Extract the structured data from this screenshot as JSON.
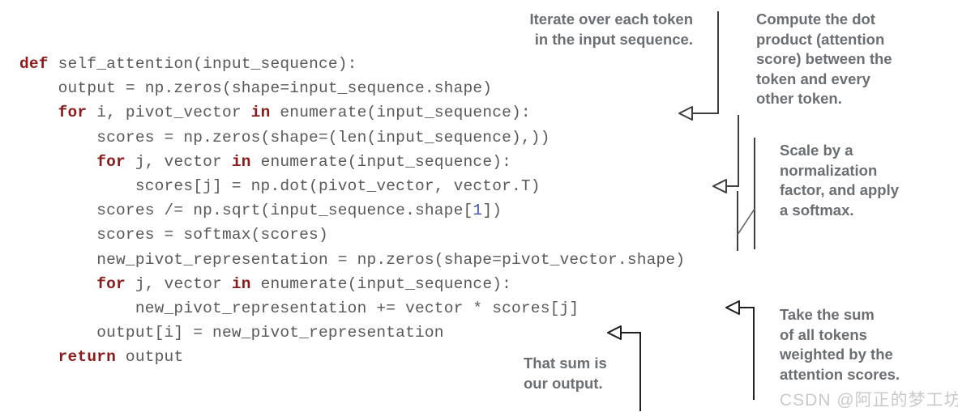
{
  "figure": {
    "kind": "annotated-code-figure",
    "background_color": "#ffffff"
  },
  "code": {
    "language": "python",
    "colors": {
      "text": "#58595b",
      "keyword": "#8b1a1a",
      "number": "#3a53c9"
    },
    "lines": [
      {
        "indent": 0,
        "tokens": [
          {
            "t": "def",
            "k": "kw"
          },
          {
            "t": " self_attention(input_sequence):",
            "k": "tx"
          }
        ]
      },
      {
        "indent": 1,
        "tokens": [
          {
            "t": "output = np.zeros(shape=input_sequence.shape)",
            "k": "tx"
          }
        ]
      },
      {
        "indent": 1,
        "tokens": [
          {
            "t": "for",
            "k": "kw"
          },
          {
            "t": " i, pivot_vector ",
            "k": "tx"
          },
          {
            "t": "in",
            "k": "kw"
          },
          {
            "t": " enumerate(input_sequence):",
            "k": "tx"
          }
        ]
      },
      {
        "indent": 2,
        "tokens": [
          {
            "t": "scores = np.zeros(shape=(len(input_sequence),))",
            "k": "tx"
          }
        ]
      },
      {
        "indent": 2,
        "tokens": [
          {
            "t": "for",
            "k": "kw"
          },
          {
            "t": " j, vector ",
            "k": "tx"
          },
          {
            "t": "in",
            "k": "kw"
          },
          {
            "t": " enumerate(input_sequence):",
            "k": "tx"
          }
        ]
      },
      {
        "indent": 3,
        "tokens": [
          {
            "t": "scores[j] = np.dot(pivot_vector, vector.T)",
            "k": "tx"
          }
        ]
      },
      {
        "indent": 2,
        "tokens": [
          {
            "t": "scores /= np.sqrt(input_sequence.shape[",
            "k": "tx"
          },
          {
            "t": "1",
            "k": "num"
          },
          {
            "t": "])",
            "k": "tx"
          }
        ]
      },
      {
        "indent": 2,
        "tokens": [
          {
            "t": "scores = softmax(scores)",
            "k": "tx"
          }
        ]
      },
      {
        "indent": 2,
        "tokens": [
          {
            "t": "new_pivot_representation = np.zeros(shape=pivot_vector.shape)",
            "k": "tx"
          }
        ]
      },
      {
        "indent": 2,
        "tokens": [
          {
            "t": "for",
            "k": "kw"
          },
          {
            "t": " j, vector ",
            "k": "tx"
          },
          {
            "t": "in",
            "k": "kw"
          },
          {
            "t": " enumerate(input_sequence):",
            "k": "tx"
          }
        ]
      },
      {
        "indent": 3,
        "tokens": [
          {
            "t": "new_pivot_representation += vector * scores[j]",
            "k": "tx"
          }
        ]
      },
      {
        "indent": 2,
        "tokens": [
          {
            "t": "output[i] = new_pivot_representation",
            "k": "tx"
          }
        ]
      },
      {
        "indent": 1,
        "tokens": [
          {
            "t": "return",
            "k": "kw"
          },
          {
            "t": " output",
            "k": "tx"
          }
        ]
      }
    ]
  },
  "annotations": {
    "color": "#6b6e72",
    "iterate_tokens": "Iterate over each token\nin the input sequence.",
    "compute_dot_product": "Compute the dot\nproduct (attention\nscore) between the\ntoken and every\nother token.",
    "scale_normalize": "Scale by a\nnormalization\nfactor, and apply\na softmax.",
    "take_the_sum": "Take the sum\nof all tokens\nweighted by the\nattention scores.",
    "that_sum": "That sum is\nour output."
  },
  "watermark": {
    "text": "CSDN @阿正的梦工坊",
    "color": "#c9c9c9"
  }
}
